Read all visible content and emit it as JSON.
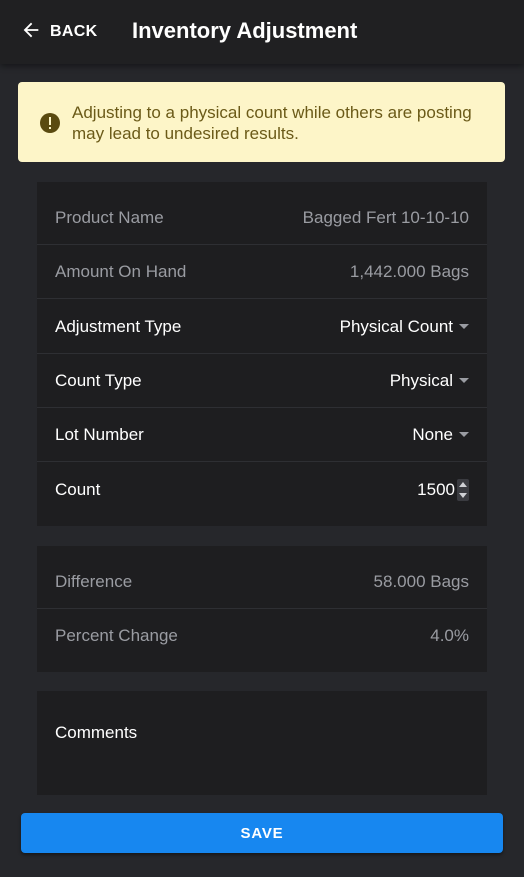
{
  "header": {
    "back_label": "BACK",
    "title": "Inventory Adjustment"
  },
  "alert": {
    "icon": "exclamation-circle-icon",
    "message": "Adjusting to a physical count while others are posting may lead to undesired results.",
    "background": "#fdf5c8",
    "text_color": "#6b5a18"
  },
  "details": {
    "product_name": {
      "label": "Product Name",
      "value": "Bagged Fert 10-10-10"
    },
    "amount_on_hand": {
      "label": "Amount On Hand",
      "value": "1,442.000 Bags"
    },
    "adjustment_type": {
      "label": "Adjustment Type",
      "value": "Physical Count"
    },
    "count_type": {
      "label": "Count Type",
      "value": "Physical"
    },
    "lot_number": {
      "label": "Lot Number",
      "value": "None"
    },
    "count": {
      "label": "Count",
      "value": "1500"
    }
  },
  "summary": {
    "difference": {
      "label": "Difference",
      "value": "58.000 Bags"
    },
    "percent_change": {
      "label": "Percent Change",
      "value": "4.0%"
    }
  },
  "comments": {
    "label": "Comments"
  },
  "save": {
    "label": "SAVE",
    "color": "#1787f0"
  }
}
